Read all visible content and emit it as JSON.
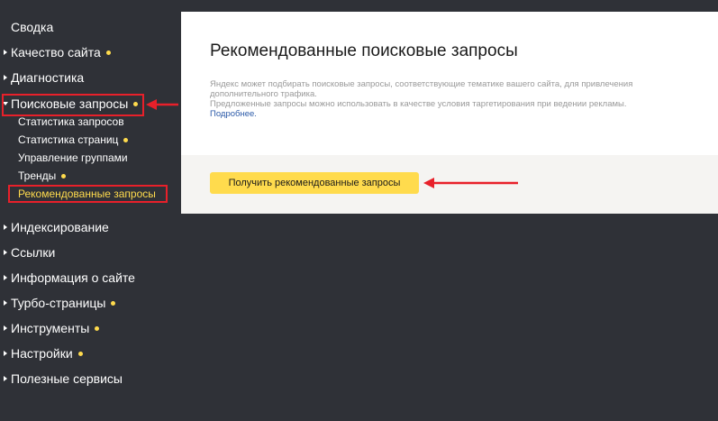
{
  "sidebar": {
    "items": [
      {
        "label": "Сводка"
      },
      {
        "label": "Качество сайта"
      },
      {
        "label": "Диагностика"
      },
      {
        "label": "Поисковые запросы"
      },
      {
        "label": "Индексирование"
      },
      {
        "label": "Ссылки"
      },
      {
        "label": "Информация о сайте"
      },
      {
        "label": "Турбо-страницы"
      },
      {
        "label": "Инструменты"
      },
      {
        "label": "Настройки"
      },
      {
        "label": "Полезные сервисы"
      }
    ],
    "subitems": [
      {
        "label": "Статистика запросов"
      },
      {
        "label": "Статистика страниц"
      },
      {
        "label": "Управление группами"
      },
      {
        "label": "Тренды"
      },
      {
        "label": "Рекомендованные запросы"
      }
    ]
  },
  "main": {
    "title": "Рекомендованные поисковые запросы",
    "description_line1": "Яндекс может подбирать поисковые запросы, соответствующие тематике вашего сайта, для привлечения дополнительного трафика.",
    "description_line2": "Предложенные запросы можно использовать в качестве условия таргетирования при ведении рекламы.",
    "more_link": "Подробнее.",
    "button_label": "Получить рекомендованные запросы"
  },
  "colors": {
    "sidebar_bg": "#2f3137",
    "accent_yellow": "#ffdb4d",
    "annotation_red": "#e8202a",
    "link_blue": "#2b5aa8"
  }
}
